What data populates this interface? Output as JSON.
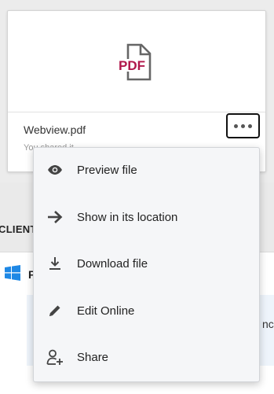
{
  "file_card": {
    "thumbnail_icon": "pdf-file-icon",
    "thumbnail_text": "PDF",
    "file_name": "Webview.pdf",
    "sub_text": "You shared it",
    "more_button_icon": "more-options-icon",
    "accent_color": "#b0174b"
  },
  "context_menu": {
    "items": [
      {
        "label": "Preview file",
        "icon": "eye-icon"
      },
      {
        "label": "Show in its location",
        "icon": "arrow-right-icon"
      },
      {
        "label": "Download file",
        "icon": "download-icon"
      },
      {
        "label": "Edit Online",
        "icon": "pencil-icon"
      },
      {
        "label": "Share",
        "icon": "share-user-icon"
      }
    ]
  },
  "background": {
    "section_label": "CLIENT",
    "row_letter": "F",
    "row_icon": "windows-logo-icon",
    "info_tail": "nc"
  }
}
